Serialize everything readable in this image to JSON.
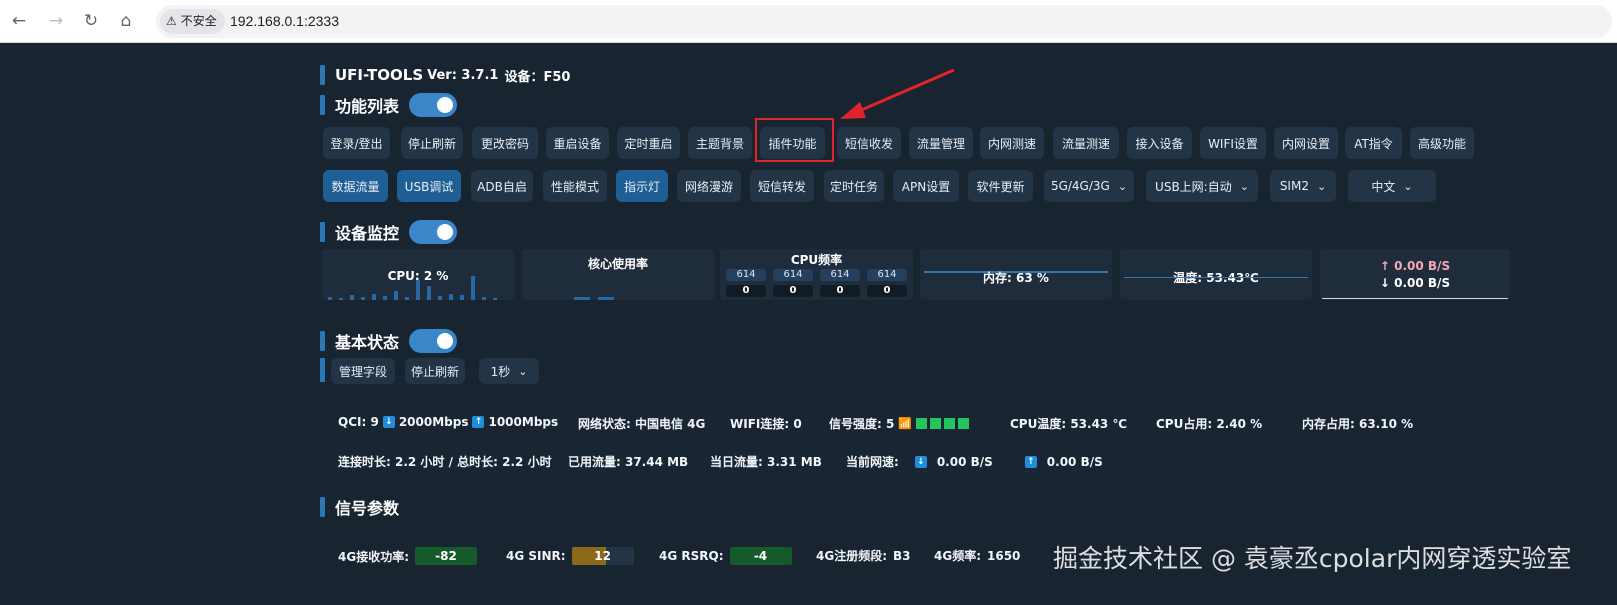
{
  "browser": {
    "security_label": "不安全",
    "url": "192.168.0.1:2333"
  },
  "header": {
    "app_name": "UFI-TOOLS",
    "version": "Ver: 3.7.1",
    "device": "设备：F50"
  },
  "sections": {
    "features": "功能列表",
    "monitor": "设备监控",
    "basic_status": "基本状态",
    "signal": "信号参数"
  },
  "features_row1": [
    "登录/登出",
    "停止刷新",
    "更改密码",
    "重启设备",
    "定时重启",
    "主题背景",
    "插件功能",
    "短信收发",
    "流量管理",
    "内网测速",
    "流量测速",
    "接入设备",
    "WIFI设置",
    "内网设置",
    "AT指令",
    "高级功能"
  ],
  "features_row2": [
    "数据流量",
    "USB调试",
    "ADB自启",
    "性能模式",
    "指示灯",
    "网络漫游",
    "短信转发",
    "定时任务",
    "APN设置",
    "软件更新"
  ],
  "selects": {
    "network_mode": "5G/4G/3G",
    "usb_mode": "USB上网:自动",
    "sim": "SIM2",
    "language": "中文"
  },
  "monitor": {
    "cpu": "CPU: 2 %",
    "core_usage": "核心使用率",
    "cpu_freq": "CPU频率",
    "freq_top": [
      "614",
      "614",
      "614",
      "614"
    ],
    "freq_bottom": [
      "0",
      "0",
      "0",
      "0"
    ],
    "memory": "内存: 63 %",
    "temperature": "温度: 53.43℃",
    "upload": "↑ 0.00 B/S",
    "download": "↓ 0.00 B/S",
    "upload_color": "#f4a8b8"
  },
  "basic_controls": {
    "manage_fields": "管理字段",
    "stop_refresh": "停止刷新",
    "interval": "1秒"
  },
  "status": {
    "qci": "QCI: 9",
    "down_speed": "2000Mbps",
    "up_speed": "1000Mbps",
    "network_status": "网络状态: 中国电信 4G",
    "wifi": "WIFI连接: 0",
    "signal": "信号强度: 5",
    "cpu_temp": "CPU温度:   53.43 ℃",
    "cpu_usage": "CPU占用:   2.40 %",
    "mem_usage": "内存占用:   63.10 %",
    "connect_time": "连接时长: 2.2 小时 / 总时长: 2.2 小时",
    "used_traffic": "已用流量: 37.44 MB",
    "today_traffic": "当日流量: 3.31 MB",
    "current_speed": "当前网速:",
    "cur_down": "0.00 B/S",
    "cur_up": "0.00 B/S"
  },
  "signal_params": {
    "rsrp_label": "4G接收功率:",
    "rsrp": "-82",
    "sinr_label": "4G SINR:",
    "sinr": "12",
    "rsrq_label": "4G RSRQ:",
    "rsrq": "-4",
    "band_label": "4G注册频段:",
    "band": "B3",
    "freq_label": "4G频率:",
    "freq": "1650"
  },
  "colors": {
    "accent": "#1e5f96",
    "highlight": "#e0242d",
    "signal_green": "#22c55e"
  },
  "watermark": "掘金技术社区 @ 袁豪丞cpolar内网穿透实验室"
}
